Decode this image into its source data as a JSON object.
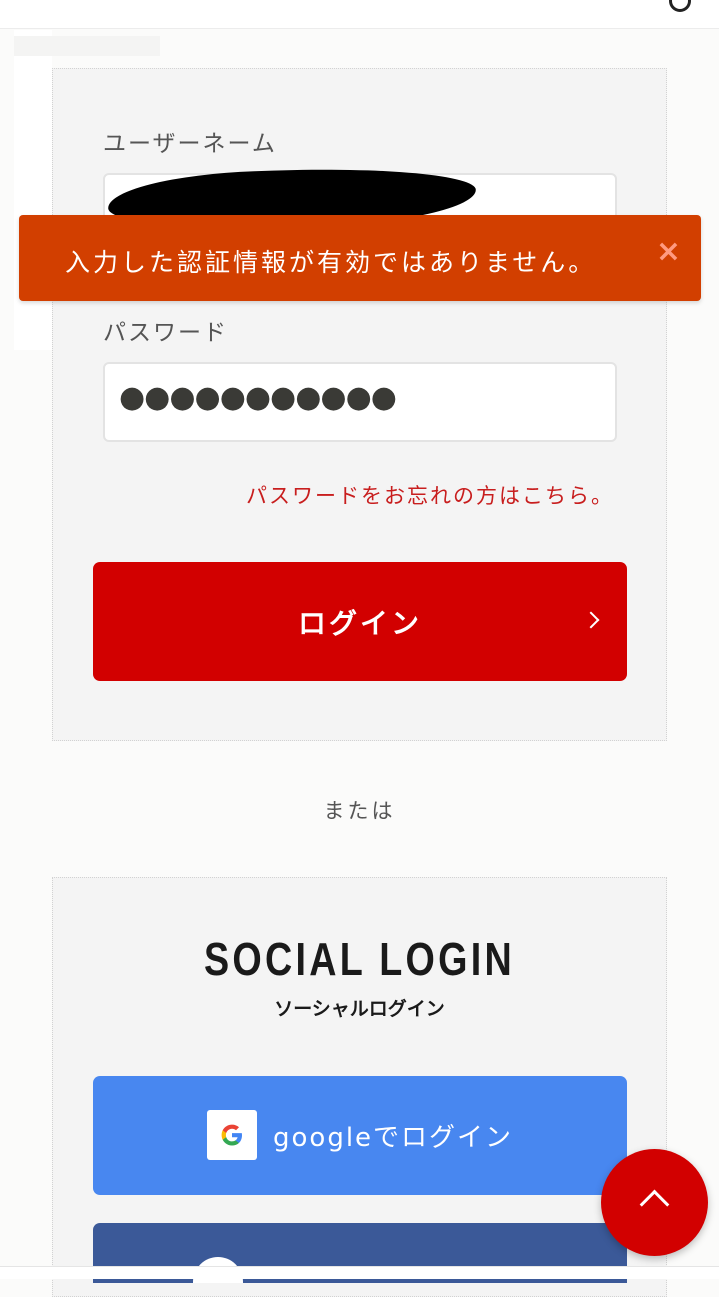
{
  "login": {
    "username_label": "ユーザーネーム",
    "username_value": "",
    "password_label": "パスワード",
    "password_value": "●●●●●●●●●●●",
    "forgot_link": "パスワードをお忘れの方はこちら。",
    "login_button": "ログイン"
  },
  "toast": {
    "message": "入力した認証情報が有効ではありません。",
    "close": "×",
    "color": "#d23f00"
  },
  "separator": {
    "or_text": "または"
  },
  "social": {
    "title": "SOCIAL LOGIN",
    "subtitle": "ソーシャルログイン",
    "google_button": "googleでログイン",
    "google_icon": "google-icon",
    "facebook_icon": "facebook-icon"
  },
  "colors": {
    "primary_red": "#d20000",
    "google_blue": "#4887f0",
    "facebook_blue": "#3b5998"
  },
  "icons": {
    "scroll_top": "chevron-up-icon",
    "login_arrow": "chevron-right-icon"
  }
}
